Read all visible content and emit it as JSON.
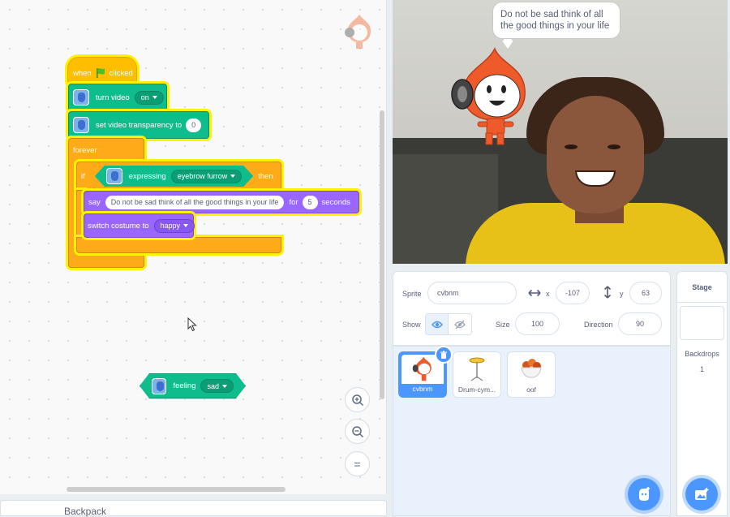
{
  "code": {
    "hat": {
      "when": "when",
      "clicked": "clicked"
    },
    "turn_video": {
      "label": "turn video",
      "value": "on"
    },
    "transparency": {
      "label": "set video transparency to",
      "value": "0"
    },
    "forever": "forever",
    "if_block": {
      "if": "if",
      "expressing": "expressing",
      "expression": "eyebrow furrow",
      "then": "then"
    },
    "say": {
      "say": "say",
      "message": "Do not be sad think of all the good things in your life",
      "for": "for",
      "secs": "5",
      "seconds": "seconds"
    },
    "costume": {
      "label": "switch costume to",
      "value": "happy"
    },
    "feeling": {
      "label": "feeling",
      "value": "sad"
    }
  },
  "zoom": {
    "in": "+",
    "out": "−",
    "reset": "="
  },
  "backpack": "Backpack",
  "stage": {
    "speech": "Do not be sad think of all the good things in your life"
  },
  "sprite_info": {
    "sprite_label": "Sprite",
    "sprite_name": "cvbnm",
    "x_label": "x",
    "x": "-107",
    "y_label": "y",
    "y": "63",
    "show_label": "Show",
    "size_label": "Size",
    "size": "100",
    "direction_label": "Direction",
    "direction": "90"
  },
  "sprites": [
    {
      "name": "cvbnm"
    },
    {
      "name": "Drum-cym..."
    },
    {
      "name": "oof"
    }
  ],
  "stage_pane": {
    "title": "Stage",
    "backdrops_label": "Backdrops",
    "backdrops_count": "1"
  },
  "colors": {
    "accent": "#4c97ff",
    "events": "#ffbf00",
    "control": "#ffab19",
    "video": "#0fbd8c",
    "looks": "#9966ff",
    "glow": "#fff200"
  }
}
